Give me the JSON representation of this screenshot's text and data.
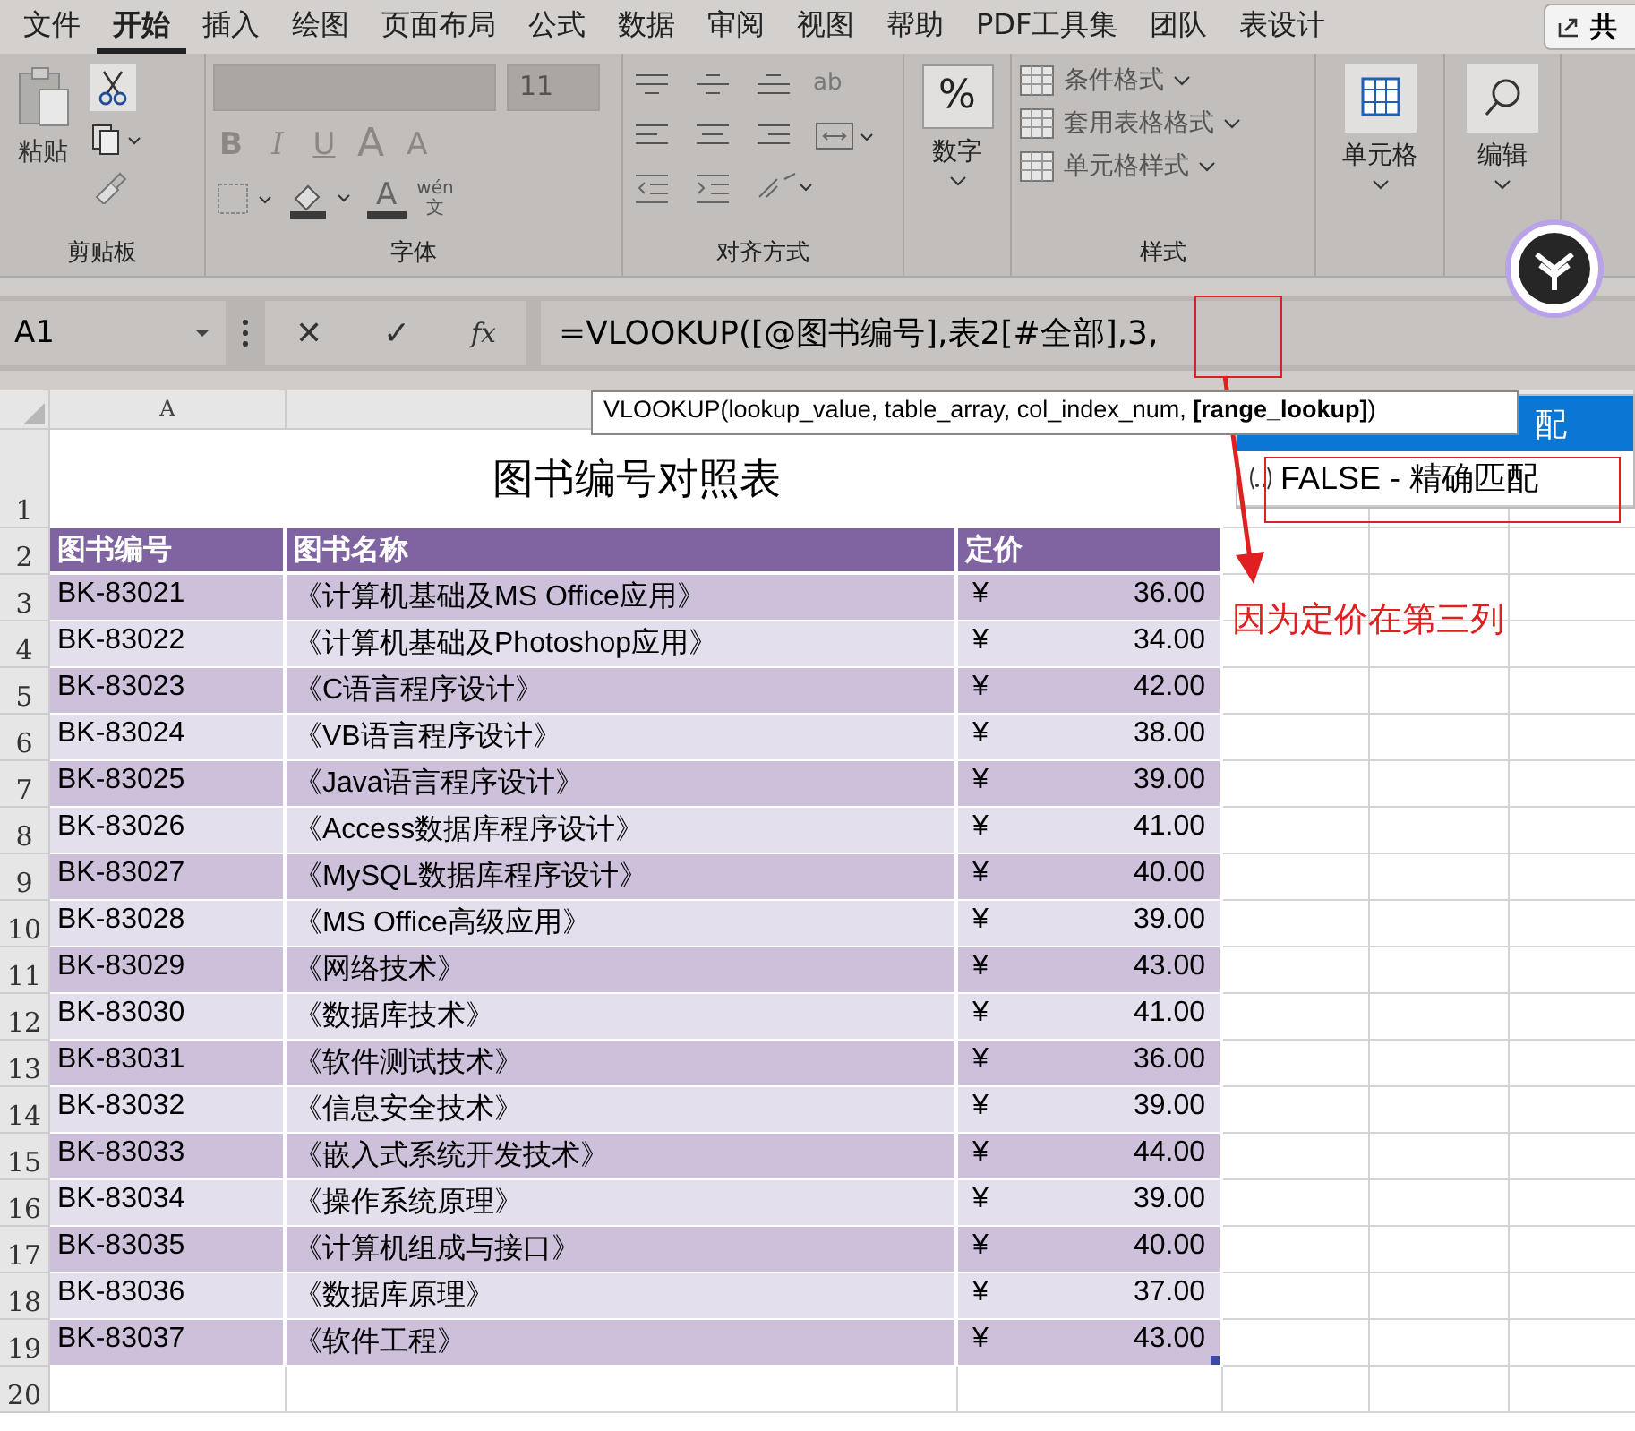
{
  "menu_tabs": [
    {
      "label": "文件",
      "selected": false
    },
    {
      "label": "开始",
      "selected": true
    },
    {
      "label": "插入",
      "selected": false
    },
    {
      "label": "绘图",
      "selected": false
    },
    {
      "label": "页面布局",
      "selected": false
    },
    {
      "label": "公式",
      "selected": false
    },
    {
      "label": "数据",
      "selected": false
    },
    {
      "label": "审阅",
      "selected": false
    },
    {
      "label": "视图",
      "selected": false
    },
    {
      "label": "帮助",
      "selected": false
    },
    {
      "label": "PDF工具集",
      "selected": false
    },
    {
      "label": "团队",
      "selected": false
    },
    {
      "label": "表设计",
      "selected": false
    }
  ],
  "share_button": "共",
  "ribbon": {
    "clipboard": {
      "paste": "粘贴",
      "label": "剪贴板"
    },
    "font": {
      "size": "11",
      "bold": "B",
      "italic": "I",
      "underline": "U",
      "grow": "A",
      "shrink": "A",
      "color_glyph": "A",
      "phonetic_top": "wén",
      "phonetic_bottom": "文",
      "label": "字体"
    },
    "alignment": {
      "wrap_glyph": "ab",
      "label": "对齐方式"
    },
    "number": {
      "glyph": "%",
      "label": "数字"
    },
    "styles": {
      "items": [
        "条件格式",
        "套用表格格式",
        "单元格样式"
      ],
      "label": "样式"
    },
    "cells": {
      "label": "单元格"
    },
    "editing": {
      "label": "编辑"
    }
  },
  "formula_bar": {
    "name_box": "A1",
    "cancel": "✕",
    "enter": "✓",
    "fx": "fx",
    "formula": "=VLOOKUP([@图书编号],表2[#全部],3,"
  },
  "tooltip": "VLOOKUP(lookup_value, table_array, col_index_num, **[range_lookup]**)",
  "dropdown": [
    {
      "text": "配",
      "selected": true
    },
    {
      "text": "FALSE - 精确匹配",
      "selected": false
    }
  ],
  "column_headers": [
    "A"
  ],
  "row_numbers": [
    "1",
    "2",
    "3",
    "4",
    "5",
    "6",
    "7",
    "8",
    "9",
    "10",
    "11",
    "12",
    "13",
    "14",
    "15",
    "16",
    "17",
    "18",
    "19",
    "20"
  ],
  "title": "图书编号对照表",
  "table": {
    "columns": [
      "图书编号",
      "图书名称",
      "定价"
    ],
    "rows": [
      {
        "id": "BK-83021",
        "name": "《计算机基础及MS Office应用》",
        "currency": "¥",
        "price": "36.00"
      },
      {
        "id": "BK-83022",
        "name": "《计算机基础及Photoshop应用》",
        "currency": "¥",
        "price": "34.00"
      },
      {
        "id": "BK-83023",
        "name": "《C语言程序设计》",
        "currency": "¥",
        "price": "42.00"
      },
      {
        "id": "BK-83024",
        "name": "《VB语言程序设计》",
        "currency": "¥",
        "price": "38.00"
      },
      {
        "id": "BK-83025",
        "name": "《Java语言程序设计》",
        "currency": "¥",
        "price": "39.00"
      },
      {
        "id": "BK-83026",
        "name": "《Access数据库程序设计》",
        "currency": "¥",
        "price": "41.00"
      },
      {
        "id": "BK-83027",
        "name": "《MySQL数据库程序设计》",
        "currency": "¥",
        "price": "40.00"
      },
      {
        "id": "BK-83028",
        "name": "《MS Office高级应用》",
        "currency": "¥",
        "price": "39.00"
      },
      {
        "id": "BK-83029",
        "name": "《网络技术》",
        "currency": "¥",
        "price": "43.00"
      },
      {
        "id": "BK-83030",
        "name": "《数据库技术》",
        "currency": "¥",
        "price": "41.00"
      },
      {
        "id": "BK-83031",
        "name": "《软件测试技术》",
        "currency": "¥",
        "price": "36.00"
      },
      {
        "id": "BK-83032",
        "name": "《信息安全技术》",
        "currency": "¥",
        "price": "39.00"
      },
      {
        "id": "BK-83033",
        "name": "《嵌入式系统开发技术》",
        "currency": "¥",
        "price": "44.00"
      },
      {
        "id": "BK-83034",
        "name": "《操作系统原理》",
        "currency": "¥",
        "price": "39.00"
      },
      {
        "id": "BK-83035",
        "name": "《计算机组成与接口》",
        "currency": "¥",
        "price": "40.00"
      },
      {
        "id": "BK-83036",
        "name": "《数据库原理》",
        "currency": "¥",
        "price": "37.00"
      },
      {
        "id": "BK-83037",
        "name": "《软件工程》",
        "currency": "¥",
        "price": "43.00"
      }
    ]
  },
  "annotation": "因为定价在第三列"
}
